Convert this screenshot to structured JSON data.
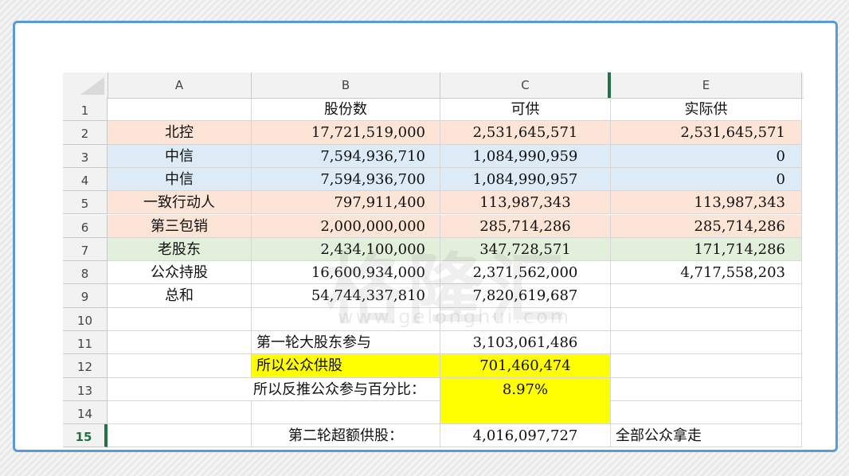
{
  "columns": [
    "A",
    "B",
    "C",
    "E"
  ],
  "rows": [
    {
      "num": "1",
      "a": "",
      "b": "股份数",
      "c": "可供",
      "e": "实际供"
    },
    {
      "num": "2",
      "a": "北控",
      "b": "17,721,519,000",
      "c": "2,531,645,571",
      "e": "2,531,645,571"
    },
    {
      "num": "3",
      "a": "中信",
      "b": "7,594,936,710",
      "c": "1,084,990,959",
      "e": "0"
    },
    {
      "num": "4",
      "a": "中信",
      "b": "7,594,936,700",
      "c": "1,084,990,957",
      "e": "0"
    },
    {
      "num": "5",
      "a": "一致行动人",
      "b": "797,911,400",
      "c": "113,987,343",
      "e": "113,987,343"
    },
    {
      "num": "6",
      "a": "第三包销",
      "b": "2,000,000,000",
      "c": "285,714,286",
      "e": "285,714,286"
    },
    {
      "num": "7",
      "a": "老股东",
      "b": "2,434,100,000",
      "c": "347,728,571",
      "e": "171,714,286"
    },
    {
      "num": "8",
      "a": "公众持股",
      "b": "16,600,934,000",
      "c": "2,371,562,000",
      "e": "4,717,558,203"
    },
    {
      "num": "9",
      "a": "总和",
      "b": "54,744,337,810",
      "c": "7,820,619,687",
      "e": ""
    },
    {
      "num": "10",
      "a": "",
      "b": "",
      "c": "",
      "e": ""
    },
    {
      "num": "11",
      "a": "",
      "b": "第一轮大股东参与",
      "c": "3,103,061,486",
      "e": ""
    },
    {
      "num": "12",
      "a": "",
      "b": "所以公众供股",
      "c": "701,460,474",
      "e": ""
    },
    {
      "num": "13",
      "ab": "所以反推公众参与百分比：",
      "c": "8.97%",
      "e": ""
    },
    {
      "num": "14",
      "a": "",
      "b": "",
      "c": "",
      "e": ""
    },
    {
      "num": "15",
      "a": "",
      "b": "第二轮超额供股：",
      "c": "4,016,097,727",
      "e": "全部公众拿走"
    }
  ],
  "colors": {
    "pink": "#fce4d6",
    "blue": "#ddebf7",
    "green": "#e2efda",
    "yellow": "#ffff00",
    "frame": "#5b9bd5",
    "excel_green": "#217346"
  },
  "watermark": {
    "logo": "格隆汇",
    "url": "www.gelonghui.com"
  }
}
